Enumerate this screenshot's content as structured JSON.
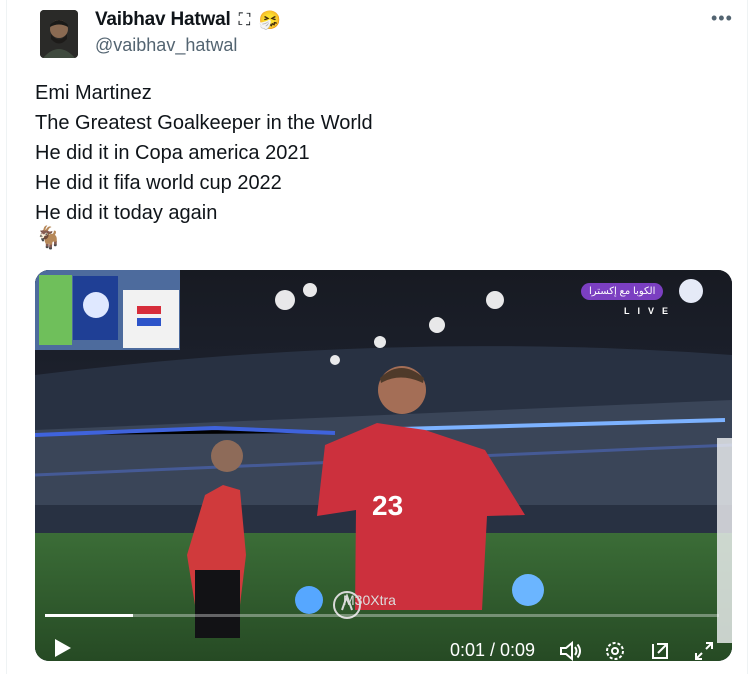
{
  "author": {
    "display_name": "Vaibhav Hatwal",
    "handle": "@vaibhav_hatwal",
    "badge_emoji": "🤧",
    "verified_symbol": "⛶"
  },
  "menu": {
    "more_label": "•••"
  },
  "tweet": {
    "text": "Emi Martinez\nThe Greatest Goalkeeper in the World\nHe did it in Copa america 2021\nHe did it fifa world cup 2022\nHe did it today again",
    "emoji": "🐐"
  },
  "video": {
    "player_number": "23",
    "watermark": "M30Xtra",
    "live_badge": "الكوبا مع إكسترا",
    "live_text": "LIVE",
    "current_time": "0:01",
    "duration": "0:09",
    "time_display": "0:01 / 0:09",
    "progress_fraction": 0.13,
    "icons": [
      "play-icon",
      "volume-icon",
      "settings-icon",
      "popout-icon",
      "fullscreen-icon"
    ]
  },
  "colors": {
    "text": "#0f1419",
    "muted": "#536471",
    "jersey": "#c9323c",
    "live_badge": "#7b3fc1",
    "pitch": "#2f5d2b"
  }
}
